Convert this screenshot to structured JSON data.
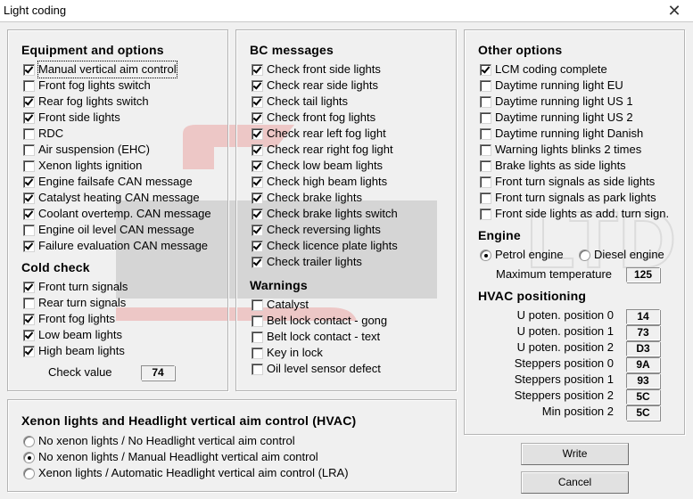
{
  "window": {
    "title": "Light coding",
    "close_glyph": "✕"
  },
  "equipment": {
    "heading": "Equipment and options",
    "items": [
      {
        "label": "Manual vertical aim control",
        "checked": true
      },
      {
        "label": "Front fog lights switch",
        "checked": false
      },
      {
        "label": "Rear fog lights switch",
        "checked": true
      },
      {
        "label": "Front side lights",
        "checked": true
      },
      {
        "label": "RDC",
        "checked": false
      },
      {
        "label": "Air suspension (EHC)",
        "checked": false
      },
      {
        "label": "Xenon lights ignition",
        "checked": false
      },
      {
        "label": "Engine failsafe CAN message",
        "checked": true
      },
      {
        "label": "Catalyst heating CAN message",
        "checked": true
      },
      {
        "label": "Coolant overtemp. CAN message",
        "checked": true
      },
      {
        "label": "Engine oil level CAN message",
        "checked": false
      },
      {
        "label": "Failure evaluation CAN message",
        "checked": true
      }
    ]
  },
  "cold_check": {
    "heading": "Cold check",
    "items": [
      {
        "label": "Front turn signals",
        "checked": true
      },
      {
        "label": "Rear turn signals",
        "checked": false
      },
      {
        "label": "Front fog lights",
        "checked": true
      },
      {
        "label": "Low beam lights",
        "checked": true
      },
      {
        "label": "High beam lights",
        "checked": true
      }
    ],
    "check_value_label": "Check value",
    "check_value": "74"
  },
  "bc_messages": {
    "heading": "BC messages",
    "items": [
      {
        "label": "Check front side lights",
        "checked": true
      },
      {
        "label": "Check rear side lights",
        "checked": true
      },
      {
        "label": "Check tail lights",
        "checked": true
      },
      {
        "label": "Check front fog lights",
        "checked": true
      },
      {
        "label": "Check rear left fog light",
        "checked": true
      },
      {
        "label": "Check rear right fog light",
        "checked": true
      },
      {
        "label": "Check low beam lights",
        "checked": true
      },
      {
        "label": "Check high beam lights",
        "checked": true
      },
      {
        "label": "Check brake lights",
        "checked": true
      },
      {
        "label": "Check brake lights switch",
        "checked": true
      },
      {
        "label": "Check reversing lights",
        "checked": true
      },
      {
        "label": "Check licence plate lights",
        "checked": true
      },
      {
        "label": "Check trailer lights",
        "checked": true
      }
    ]
  },
  "warnings": {
    "heading": "Warnings",
    "items": [
      {
        "label": "Catalyst",
        "checked": false
      },
      {
        "label": "Belt lock contact - gong",
        "checked": false
      },
      {
        "label": "Belt lock contact - text",
        "checked": false
      },
      {
        "label": "Key in lock",
        "checked": false
      },
      {
        "label": "Oil level sensor defect",
        "checked": false
      }
    ]
  },
  "other_options": {
    "heading": "Other options",
    "items": [
      {
        "label": "LCM coding complete",
        "checked": true
      },
      {
        "label": "Daytime running light EU",
        "checked": false
      },
      {
        "label": "Daytime running light US 1",
        "checked": false
      },
      {
        "label": "Daytime running light US 2",
        "checked": false
      },
      {
        "label": "Daytime running light Danish",
        "checked": false
      },
      {
        "label": "Warning lights blinks 2 times",
        "checked": false
      },
      {
        "label": "Brake lights as side lights",
        "checked": false
      },
      {
        "label": "Front turn signals as side lights",
        "checked": false
      },
      {
        "label": "Front turn signals as park lights",
        "checked": false
      },
      {
        "label": "Front side lights as add. turn sign.",
        "checked": false
      }
    ]
  },
  "engine": {
    "heading": "Engine",
    "options": [
      {
        "label": "Petrol engine",
        "selected": true
      },
      {
        "label": "Diesel engine",
        "selected": false
      }
    ],
    "max_temp_label": "Maximum temperature",
    "max_temp": "125"
  },
  "hvac_positioning": {
    "heading": "HVAC positioning",
    "items": [
      {
        "label": "U poten. position 0",
        "value": "14"
      },
      {
        "label": "U poten. position 1",
        "value": "73"
      },
      {
        "label": "U poten. position 2",
        "value": "D3"
      },
      {
        "label": "Steppers position 0",
        "value": "9A"
      },
      {
        "label": "Steppers position 1",
        "value": "93"
      },
      {
        "label": "Steppers position 2",
        "value": "5C"
      },
      {
        "label": "Min position 2",
        "value": "5C"
      }
    ]
  },
  "xenon_hvac": {
    "heading": "Xenon lights and Headlight vertical aim control (HVAC)",
    "options": [
      {
        "label": "No xenon lights / No Headlight vertical aim control",
        "selected": false
      },
      {
        "label": "No xenon lights / Manual Headlight vertical aim control",
        "selected": true
      },
      {
        "label": "Xenon lights / Automatic Headlight vertical aim control (LRA)",
        "selected": false
      }
    ]
  },
  "buttons": {
    "write": "Write",
    "cancel": "Cancel"
  },
  "watermark": {
    "text": "MOTO LTD",
    "accent": "#e53935",
    "gray": "#9e9e9e"
  }
}
